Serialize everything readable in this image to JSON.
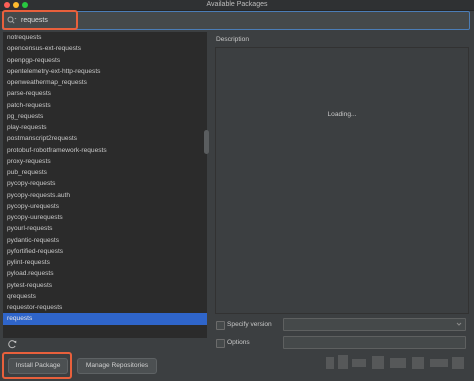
{
  "window": {
    "title": "Available Packages"
  },
  "search": {
    "value": "requests"
  },
  "packages": [
    "notrequests",
    "opencensus-ext-requests",
    "openpgp-requests",
    "opentelemetry-ext-http-requests",
    "openweathermap_requests",
    "parse-requests",
    "patch-requests",
    "pg_requests",
    "play-requests",
    "postmanscript2requests",
    "protobuf-robotframework-requests",
    "proxy-requests",
    "pub_requests",
    "pycopy-requests",
    "pycopy-requests.auth",
    "pycopy-urequests",
    "pycopy-uurequests",
    "pyourl-requests",
    "pydantic-requests",
    "pyfortified-requests",
    "pylint-requests",
    "pyload.requests",
    "pytest-requests",
    "qrequests",
    "requestor-requests",
    "requests"
  ],
  "selected_package": "requests",
  "description": {
    "label": "Description",
    "loading": "Loading..."
  },
  "options": {
    "specify_version": "Specify version",
    "options": "Options"
  },
  "buttons": {
    "install": "Install Package",
    "manage": "Manage Repositories"
  },
  "colors": {
    "accent": "#2f65ca",
    "highlight": "#e8603c"
  }
}
